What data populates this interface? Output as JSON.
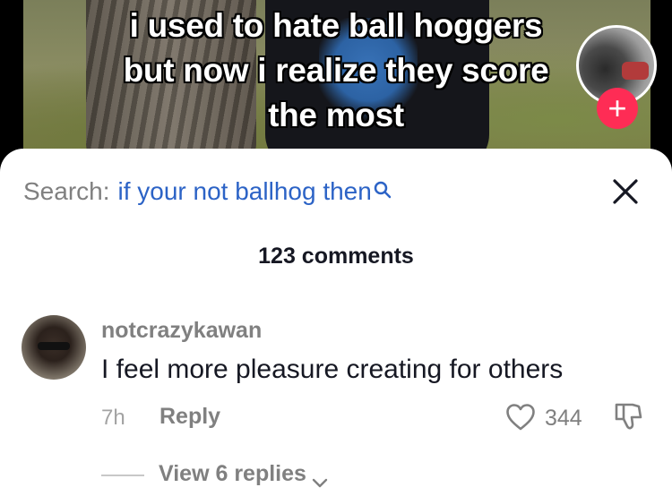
{
  "video": {
    "caption_lines": [
      "i used to hate ball hoggers",
      "but now i realize they score",
      "the most"
    ],
    "follow_symbol": "+"
  },
  "search": {
    "prefix": "Search:",
    "query": "if your not ballhog then",
    "icon": "search-icon"
  },
  "close_icon": "close-icon",
  "comments_header": {
    "count_text": "123 comments"
  },
  "comment": {
    "username": "notcrazykawan",
    "text": "I feel more pleasure creating for others",
    "time": "7h",
    "reply_label": "Reply",
    "likes": "344",
    "view_replies": "View 6 replies"
  },
  "colors": {
    "accent_red": "#fe2c55",
    "search_blue": "#2c63c6",
    "secondary_text": "#808080",
    "primary_text": "#161823"
  }
}
